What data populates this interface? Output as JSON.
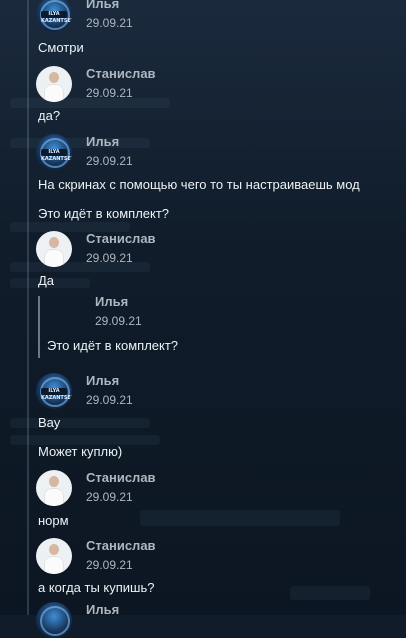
{
  "authors": {
    "ilya": "Илья",
    "stanislav": "Станислав"
  },
  "messages": [
    {
      "author": "Илья",
      "date": "29.09.21",
      "texts": [
        "Смотри"
      ]
    },
    {
      "author": "Станислав",
      "date": "29.09.21",
      "texts": [
        "да?"
      ]
    },
    {
      "author": "Илья",
      "date": "29.09.21",
      "texts": [
        "На скринах с помощью чего то ты настраиваешь мод",
        "Это идёт в комплект?"
      ]
    },
    {
      "author": "Станислав",
      "date": "29.09.21",
      "texts": [
        "Да"
      ]
    },
    {
      "author": "Илья",
      "date": "29.09.21",
      "texts": [
        "Это идёт в комплект?"
      ],
      "quoted": true
    },
    {
      "author": "Илья",
      "date": "29.09.21",
      "texts": [
        "Вау",
        "Может куплю)"
      ]
    },
    {
      "author": "Станислав",
      "date": "29.09.21",
      "texts": [
        "норм"
      ]
    },
    {
      "author": "Станислав",
      "date": "29.09.21",
      "texts": [
        "а когда ты купишь?"
      ]
    },
    {
      "author": "Илья",
      "date": "",
      "texts": []
    }
  ],
  "avatar_labels": {
    "ilya": "ILYA KAZANTSEV"
  },
  "colors": {
    "background": "#101c2a",
    "meta_text": "#aeb6c0",
    "body_text": "#eef2f6"
  }
}
